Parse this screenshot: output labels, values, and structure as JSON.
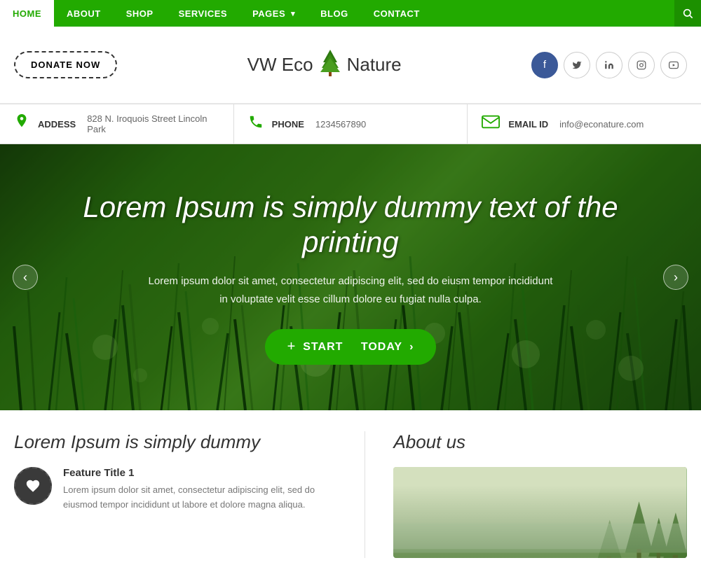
{
  "nav": {
    "items": [
      {
        "label": "HOME",
        "active": true
      },
      {
        "label": "ABOUT",
        "active": false
      },
      {
        "label": "SHOP",
        "active": false
      },
      {
        "label": "SERVICES",
        "active": false
      },
      {
        "label": "PAGES",
        "active": false,
        "hasDropdown": true
      },
      {
        "label": "BLOG",
        "active": false
      },
      {
        "label": "CONTACT",
        "active": false
      }
    ]
  },
  "header": {
    "donate_label": "DONATE NOW",
    "logo_vw": "VW Eco",
    "logo_nature": "Nature",
    "social": [
      "f",
      "t",
      "in",
      "ig",
      "yt"
    ]
  },
  "info_bar": {
    "address_label": "ADDESS",
    "address_value": "828 N. Iroquois Street Lincoln Park",
    "phone_label": "PHONE",
    "phone_value": "1234567890",
    "email_label": "EMAIL ID",
    "email_value": "info@econature.com"
  },
  "hero": {
    "title": "Lorem Ipsum is simply dummy text of the printing",
    "subtitle_line1": "Lorem ipsum dolor sit amet, consectetur adipiscing elit, sed do eiusm tempor incididunt",
    "subtitle_line2": "in voluptate velit esse cillum dolore eu fugiat nulla culpa.",
    "btn_prefix": "START",
    "btn_suffix": "TODAY",
    "btn_arrow": "›",
    "left_arrow": "‹",
    "right_arrow": "›"
  },
  "bottom": {
    "left_title": "Lorem Ipsum is simply dummy",
    "feature_title": "Feature Title 1",
    "feature_text": "Lorem ipsum dolor sit amet, consectetur adipiscing elit, sed do eiusmod tempor incididunt ut labore et dolore magna aliqua.",
    "right_title": "About us"
  }
}
